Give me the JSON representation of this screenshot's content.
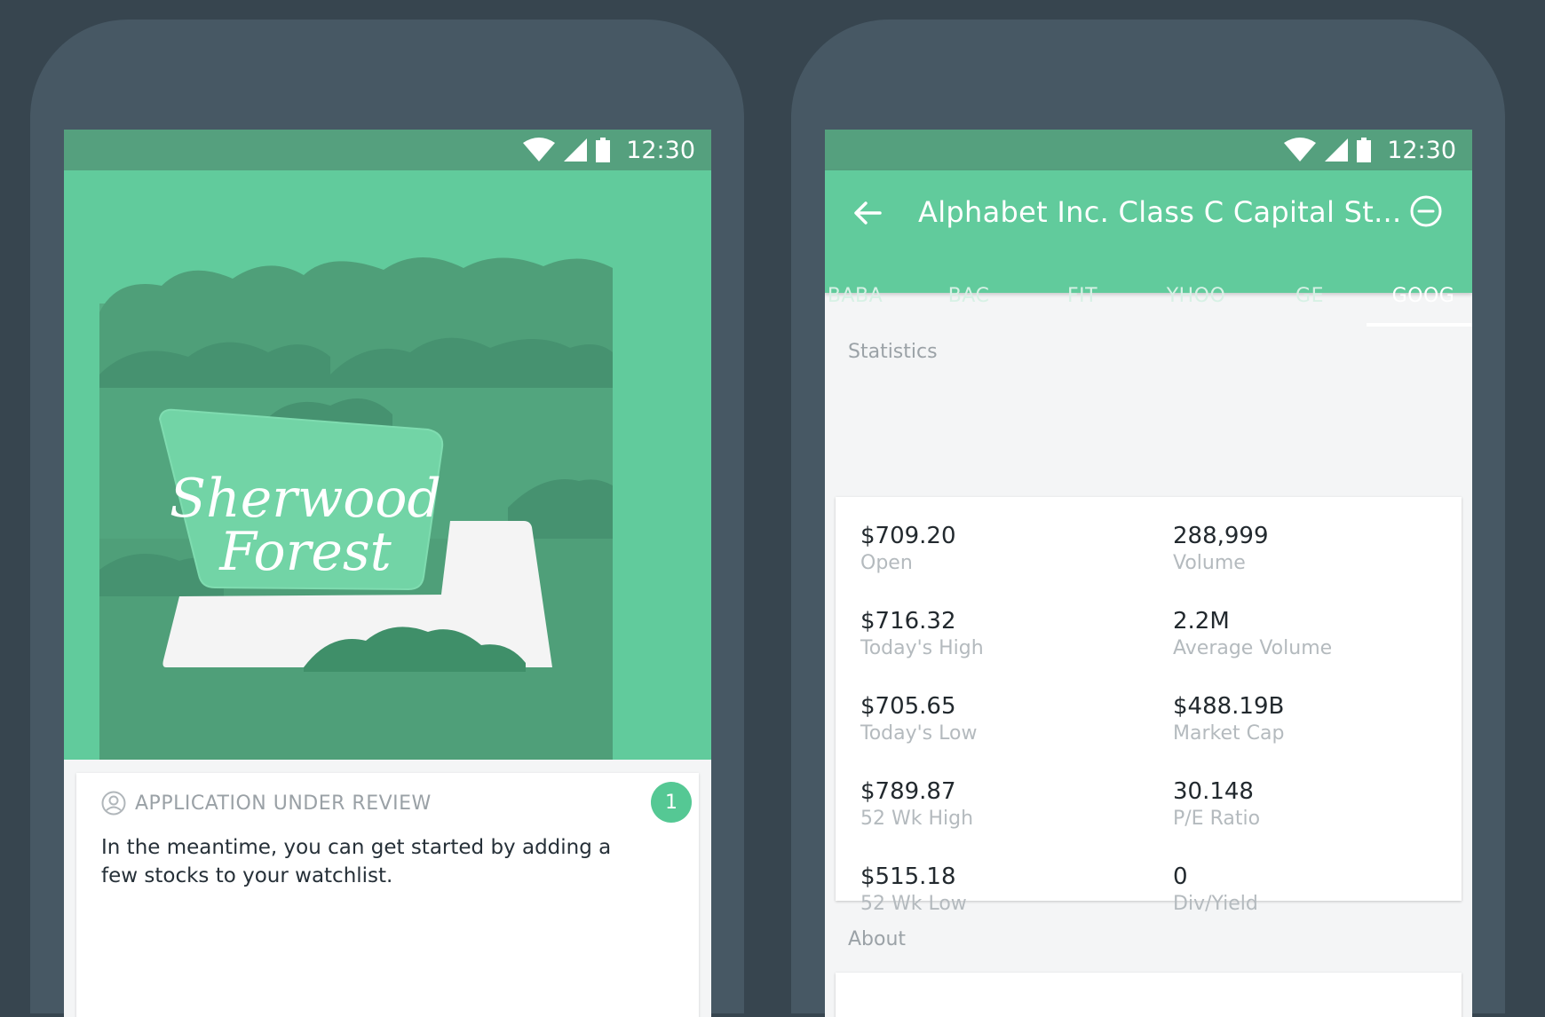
{
  "status_bar": {
    "time": "12:30"
  },
  "left_screen": {
    "illustration": {
      "sign_text_line1": "Sherwood",
      "sign_text_line2": "Forest"
    },
    "card": {
      "heading": "APPLICATION UNDER REVIEW",
      "body": "In the meantime, you can get started by adding a few stocks to your watchlist.",
      "badge_count": "1"
    }
  },
  "right_screen": {
    "title": "Alphabet Inc. Class C Capital St...",
    "tabs": [
      "BABA",
      "BAC",
      "FIT",
      "YHOO",
      "GE",
      "GOOG"
    ],
    "active_tab": "GOOG",
    "statistics_label": "Statistics",
    "statistics": [
      {
        "value": "$709.20",
        "label": "Open"
      },
      {
        "value": "288,999",
        "label": "Volume"
      },
      {
        "value": "$716.32",
        "label": "Today's High"
      },
      {
        "value": "2.2M",
        "label": "Average Volume"
      },
      {
        "value": "$705.65",
        "label": "Today's Low"
      },
      {
        "value": "$488.19B",
        "label": "Market Cap"
      },
      {
        "value": "$789.87",
        "label": "52 Wk High"
      },
      {
        "value": "30.148",
        "label": "P/E Ratio"
      },
      {
        "value": "$515.18",
        "label": "52 Wk Low"
      },
      {
        "value": "0",
        "label": "Div/Yield"
      }
    ],
    "about_label": "About"
  },
  "colors": {
    "background": "#37454f",
    "device": "#475864",
    "status_bar": "#55a07e",
    "accent_green": "#61cb9c",
    "badge_green": "#55c894"
  },
  "icons": [
    "wifi-icon",
    "cell-signal-icon",
    "battery-icon",
    "back-arrow-icon",
    "remove-circle-icon",
    "user-circle-icon"
  ]
}
